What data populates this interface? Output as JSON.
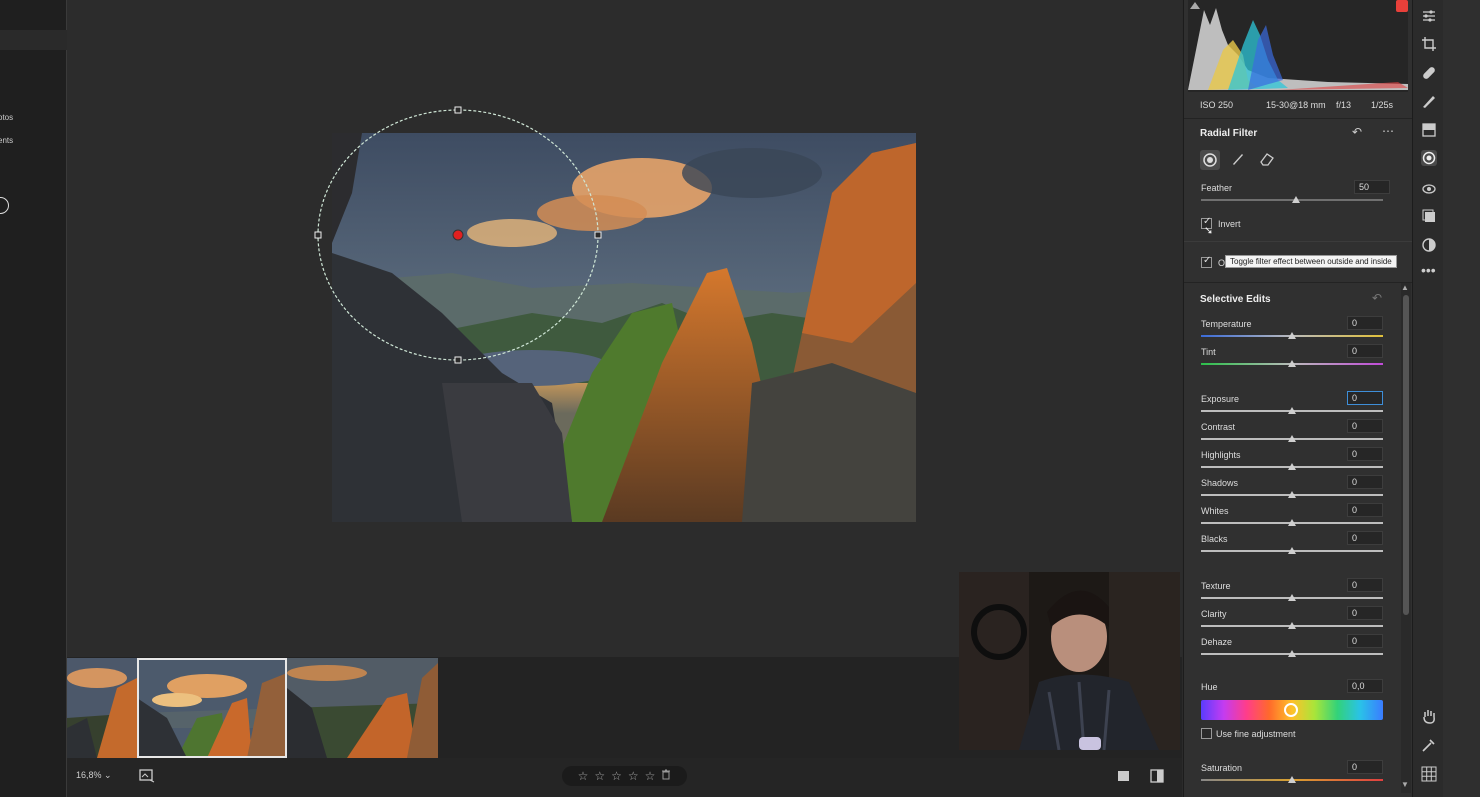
{
  "left_panel": {
    "items": [
      "otos",
      "ents"
    ]
  },
  "zoom": {
    "label": "16,8%"
  },
  "exif": {
    "iso": "ISO 250",
    "lens": "15-30@18 mm",
    "aperture": "f/13",
    "shutter": "1/25s"
  },
  "radial_filter": {
    "title": "Radial Filter",
    "feather": {
      "label": "Feather",
      "value": "50",
      "level": 0.52
    },
    "invert": {
      "label": "Invert",
      "checked": true
    },
    "overlay_checked": true,
    "overlay_letter": "O",
    "tooltip": "Toggle filter effect between outside and inside"
  },
  "selective_edits": {
    "title": "Selective Edits",
    "sliders": [
      {
        "label": "Temperature",
        "value": "0"
      },
      {
        "label": "Tint",
        "value": "0"
      },
      {
        "label": "Exposure",
        "value": "0"
      },
      {
        "label": "Contrast",
        "value": "0"
      },
      {
        "label": "Highlights",
        "value": "0"
      },
      {
        "label": "Shadows",
        "value": "0"
      },
      {
        "label": "Whites",
        "value": "0"
      },
      {
        "label": "Blacks",
        "value": "0"
      },
      {
        "label": "Texture",
        "value": "0"
      },
      {
        "label": "Clarity",
        "value": "0"
      },
      {
        "label": "Dehaze",
        "value": "0"
      },
      {
        "label": "Hue",
        "value": "0,0"
      },
      {
        "label": "Saturation",
        "value": "0"
      }
    ],
    "fine_adjustment": {
      "label": "Use fine adjustment",
      "checked": false
    }
  },
  "rating": {
    "stars": [
      "☆",
      "☆",
      "☆",
      "☆",
      "☆"
    ]
  },
  "colors": {
    "accent_blue": "#3e8ed8",
    "pin_red": "#e02020",
    "ring": "#cfe6d6"
  },
  "filmstrip": {
    "selected_index": 1
  }
}
